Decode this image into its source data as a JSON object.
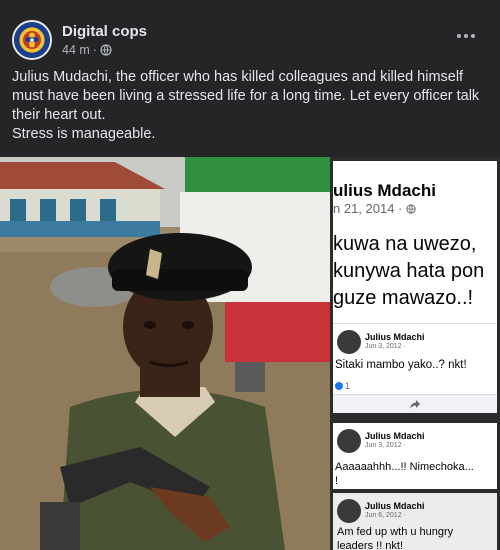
{
  "post": {
    "page_name": "Digital cops",
    "time": "44 m",
    "separator": "·",
    "privacy_icon": "globe-icon",
    "menu_icon": "more-horizontal-icon",
    "caption_lines": [
      "Julius Mudachi, the officer who has killed colleagues and killed himself must have been living a stressed life for a long time. Let every officer talk their heart out.",
      "Stress is manageable."
    ]
  },
  "screenshots": {
    "main": {
      "name": "ulius Mdachi",
      "date": "n 21, 2014 ·",
      "body_lines": [
        "kuwa na uwezo,",
        "kunywa hata pon",
        "guze mawazo..!"
      ]
    },
    "post1": {
      "name": "Julius Mdachi",
      "date": "Jun 3, 2012 ·",
      "text": "Sitaki mambo yako..? nkt!",
      "reactions": "1",
      "share_icon": "share-icon"
    },
    "post2": {
      "name": "Julius Mdachi",
      "date": "Jun 3, 2012 ·",
      "text_lines": [
        "Aaaaaahhh...!! Nimechoka...",
        "!"
      ]
    },
    "post3": {
      "name": "Julius Mdachi",
      "date": "Jun 6, 2012 ·",
      "text_lines": [
        "Am fed up wth u hungry",
        "leaders !! nkt!"
      ]
    }
  },
  "colors": {
    "background": "#242526",
    "text_primary": "#e4e6eb",
    "text_secondary": "#b0b3b8",
    "facebook_blue": "#1877f2"
  }
}
